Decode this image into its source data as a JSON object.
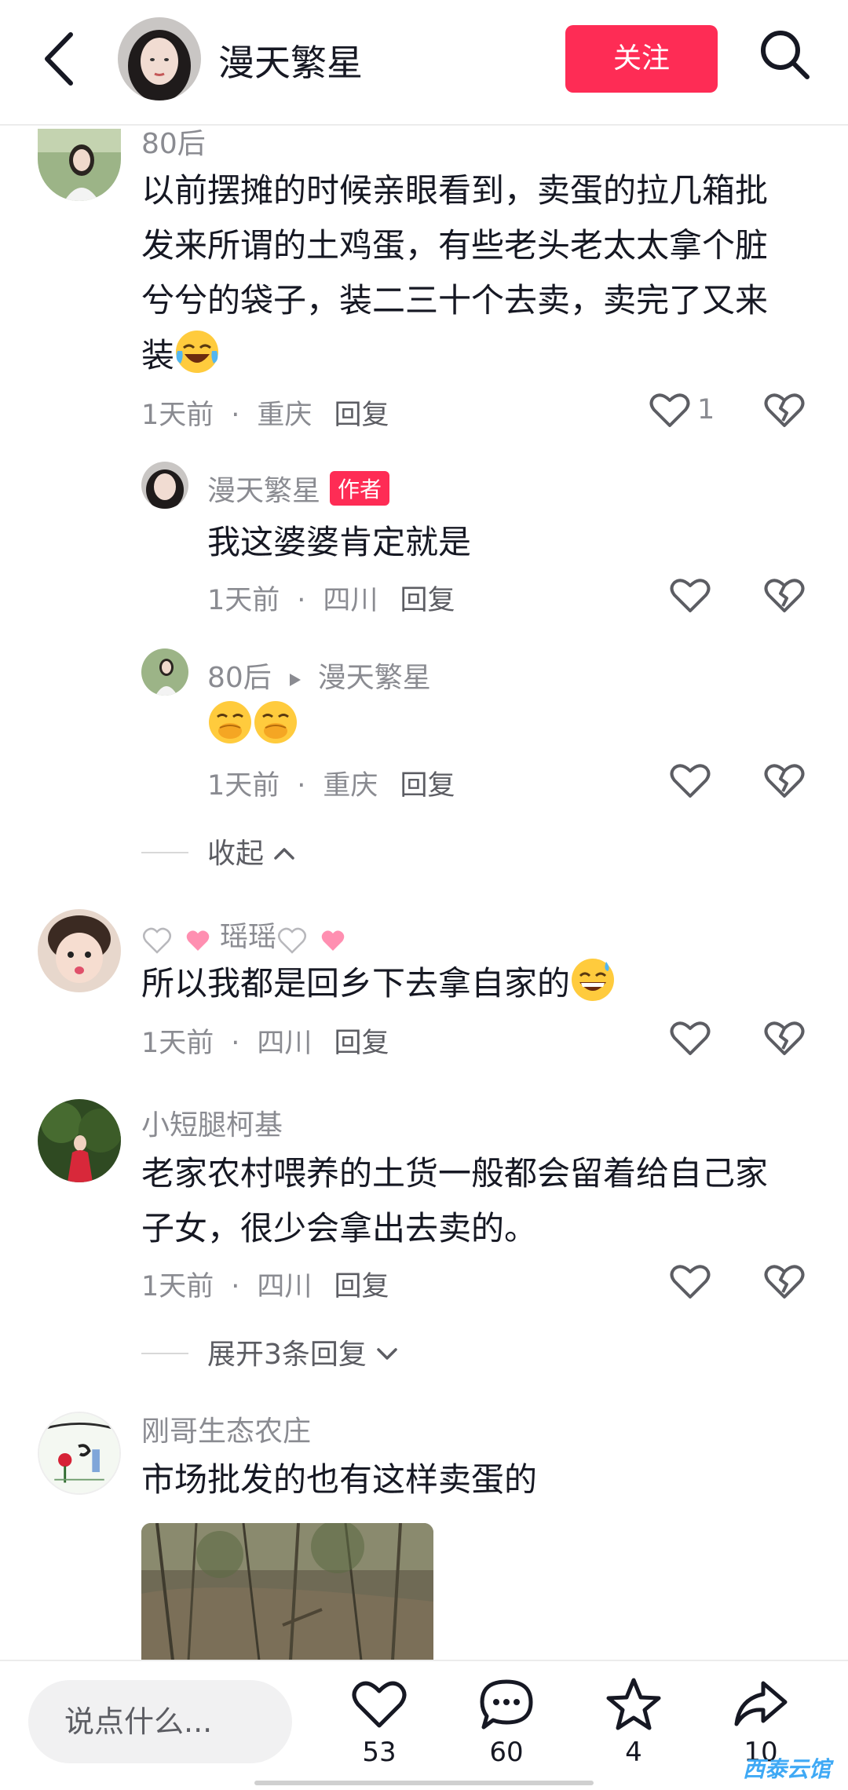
{
  "header": {
    "title": "漫天繁星",
    "follow_label": "关注"
  },
  "comments": [
    {
      "user": "80后",
      "text": "以前摆摊的时候亲眼看到，卖蛋的拉几箱批发来所谓的土鸡蛋，有些老头老太太拿个脏兮兮的袋子，装二三十个去卖，卖完了又来装",
      "emoji": "tears-of-joy",
      "time": "1天前",
      "location": "重庆",
      "reply_label": "回复",
      "likes": "1"
    },
    {
      "user": "漫天繁星",
      "badge": "作者",
      "text": "我这婆婆肯定就是",
      "time": "1天前",
      "location": "四川",
      "reply_label": "回复"
    },
    {
      "user": "80后",
      "reply_to": "漫天繁星",
      "emoji": "hand-over-mouth x2",
      "time": "1天前",
      "location": "重庆",
      "reply_label": "回复"
    },
    {
      "user": "瑶瑶",
      "text": "所以我都是回乡下去拿自家的",
      "emoji": "grinning-sweat",
      "time": "1天前",
      "location": "四川",
      "reply_label": "回复"
    },
    {
      "user": "小短腿柯基",
      "text": "老家农村喂养的土货一般都会留着给自己家子女，很少会拿出去卖的。",
      "time": "1天前",
      "location": "四川",
      "reply_label": "回复"
    },
    {
      "user": "刚哥生态农庄",
      "text": "市场批发的也有这样卖蛋的"
    }
  ],
  "collapse_label": "收起",
  "expand_label": "展开3条回复",
  "bottom_bar": {
    "input_placeholder": "说点什么...",
    "like_count": "53",
    "comment_count": "60",
    "favorite_count": "4",
    "share_count": "10"
  },
  "watermark": "西泰云馆",
  "colors": {
    "accent": "#fe2c55",
    "muted_text": "#8a8b91",
    "primary_text": "#161823"
  }
}
